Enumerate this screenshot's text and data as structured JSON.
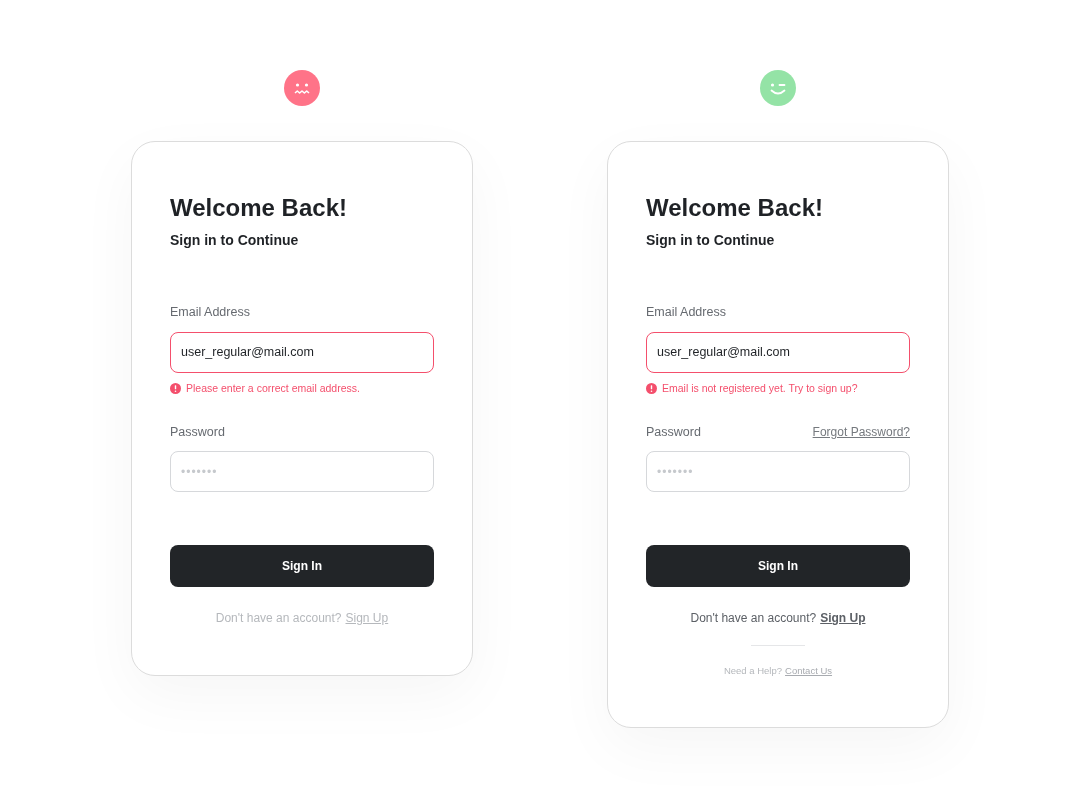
{
  "cards": [
    {
      "kind": "sad",
      "title": "Welcome Back!",
      "subtitle": "Sign in to Continue",
      "email": {
        "label": "Email Address",
        "value": "user_regular@mail.com",
        "error": "Please enter a correct email address."
      },
      "password": {
        "label": "Password",
        "placeholder": "•••••••"
      },
      "button": "Sign In",
      "signup": {
        "prompt": "Don't have an account?",
        "link": "Sign Up",
        "muted": true
      }
    },
    {
      "kind": "wink",
      "title": "Welcome Back!",
      "subtitle": "Sign in to Continue",
      "email": {
        "label": "Email Address",
        "value": "user_regular@mail.com",
        "error": "Email is not registered yet. Try to sign up?"
      },
      "password": {
        "label": "Password",
        "placeholder": "•••••••",
        "forgot": "Forgot Password?"
      },
      "button": "Sign In",
      "signup": {
        "prompt": "Don't have an account?",
        "link": "Sign Up",
        "muted": false
      },
      "help": {
        "prompt": "Need a Help?",
        "link": "Contact Us"
      }
    }
  ]
}
